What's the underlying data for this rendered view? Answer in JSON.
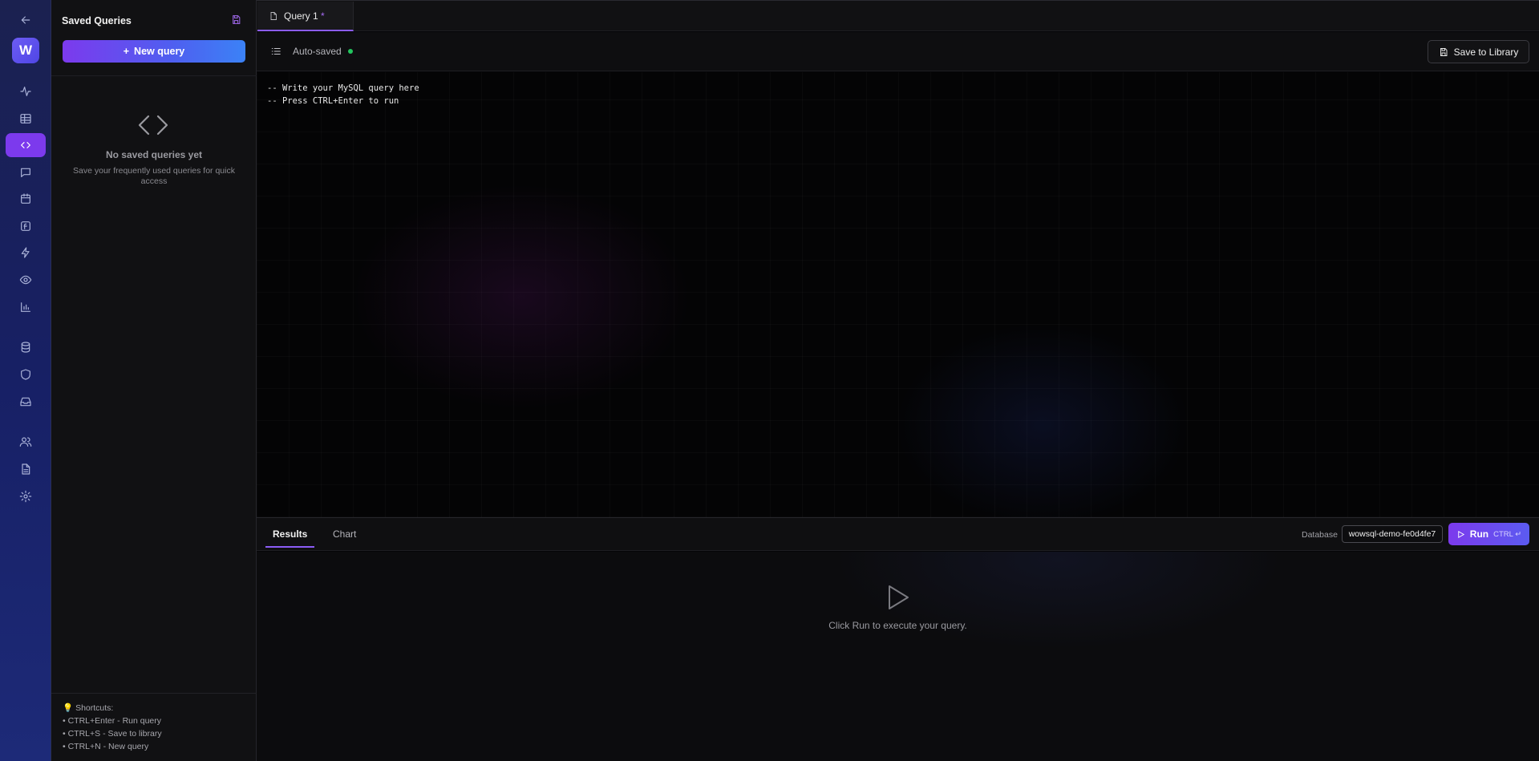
{
  "rail": {
    "logo_letter": "W",
    "items": [
      "back-arrow-icon",
      "logo",
      "activity-icon",
      "table-icon",
      "code-icon",
      "chat-icon",
      "calendar-icon",
      "function-icon",
      "lightning-icon",
      "eye-icon",
      "bar-chart-icon",
      "database-icon",
      "shield-icon",
      "inbox-icon",
      "users-icon",
      "file-text-icon",
      "settings-icon"
    ],
    "active": "code-icon"
  },
  "sidebar": {
    "title": "Saved Queries",
    "new_query_label": "New query",
    "empty_title": "No saved queries yet",
    "empty_subtitle": "Save your frequently used queries for quick access",
    "shortcuts_title": "Shortcuts:",
    "shortcuts": [
      "• CTRL+Enter - Run query",
      "• CTRL+S - Save to library",
      "• CTRL+N - New query"
    ]
  },
  "tabs": [
    {
      "label": "Query 1",
      "dirty_marker": "*"
    }
  ],
  "toolbar": {
    "autosaved_label": "Auto-saved",
    "save_library_label": "Save to Library"
  },
  "editor": {
    "lines": [
      "-- Write your MySQL query here",
      "-- Press CTRL+Enter to run"
    ]
  },
  "results_bar": {
    "tabs": [
      "Results",
      "Chart"
    ],
    "active_tab": "Results",
    "database_label": "Database",
    "database_value": "wowsql-demo-fe0d4fe7",
    "run_label": "Run",
    "run_shortcut": "CTRL ↵"
  },
  "results_panel": {
    "hint": "Click Run to execute your query."
  },
  "colors": {
    "accent": "#7c3aed",
    "autosave_dot": "#22c55e",
    "rail_bg": "#1b2150"
  }
}
